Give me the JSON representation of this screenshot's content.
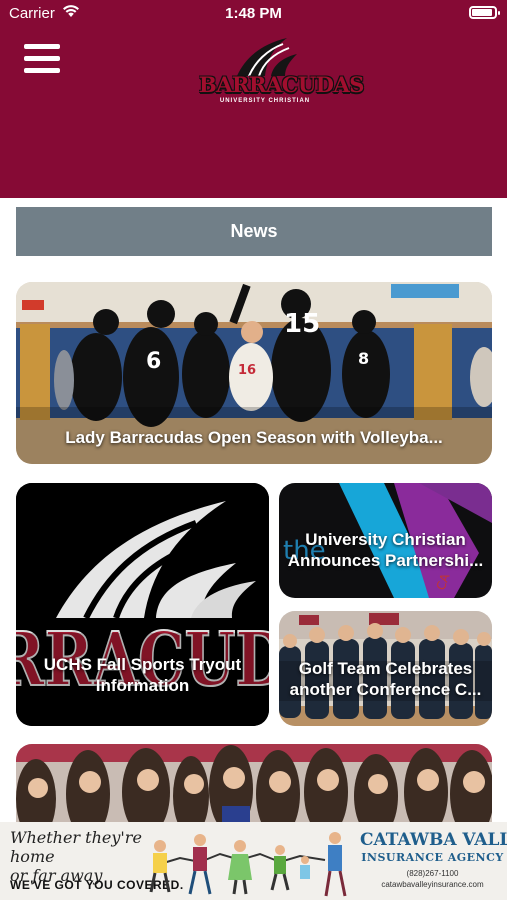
{
  "status_bar": {
    "carrier": "Carrier",
    "time": "1:48 PM"
  },
  "header": {
    "logo": {
      "word": "BARRACUDAS",
      "subtitle": "UNIVERSITY CHRISTIAN"
    },
    "background_color": "#860a35"
  },
  "news": {
    "label": "News"
  },
  "cards": [
    {
      "title": "Lady Barracudas Open Season with Volleyba..."
    },
    {
      "title": "UCHS Fall Sports Tryout\nInformation"
    },
    {
      "title": "University Christian\nAnnounces Partnershi..."
    },
    {
      "title": "Golf Team Celebrates\nanother Conference C..."
    },
    {
      "title": ""
    }
  ],
  "ad": {
    "tagline": "Whether they're home\nor far away",
    "cta": "WE'VE GOT YOU COVERED.",
    "brand": "CATAWBA VALLEY",
    "brand_sub": "INSURANCE AGENCY",
    "phone": "(828)267-1100",
    "url": "catawbavalleyinsurance.com"
  },
  "colors": {
    "maroon": "#860a35",
    "news_bar": "#717f88",
    "ad_blue": "#1f5e8c"
  }
}
